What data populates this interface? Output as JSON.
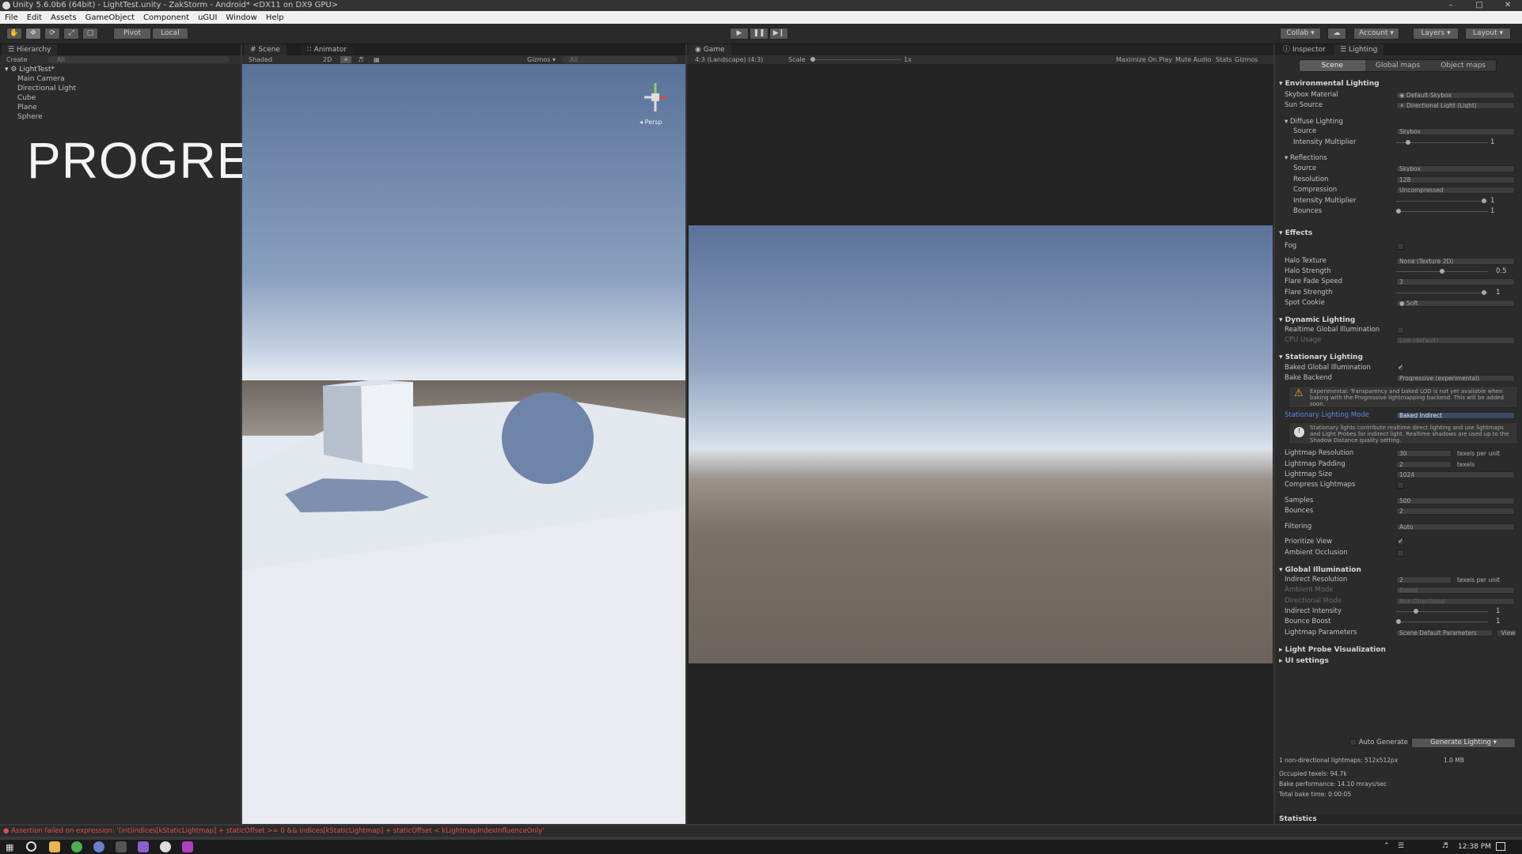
{
  "title_bar": {
    "text": "Unity 5.6.0b6 (64bit) - LightTest.unity - ZakStorm - Android* <DX11 on DX9 GPU>"
  },
  "menu": [
    "File",
    "Edit",
    "Assets",
    "GameObject",
    "Component",
    "uGUI",
    "Window",
    "Help"
  ],
  "toolbar": {
    "pivot": "Pivot",
    "local": "Local",
    "collab": "Collab",
    "account": "Account",
    "layers": "Layers",
    "layout": "Layout"
  },
  "hierarchy": {
    "tab": "Hierarchy",
    "create": "Create",
    "search_placeholder": "All",
    "scene": "LightTest*",
    "items": [
      "Main Camera",
      "Directional Light",
      "Cube",
      "Plane",
      "Sphere"
    ]
  },
  "overlay_text": "PROGRESSIVE",
  "scene_view": {
    "tab_scene": "Scene",
    "tab_animator": "Animator",
    "shading": "Shaded",
    "mode_2d": "2D",
    "gizmos": "Gizmos",
    "search": "All",
    "persp": "Persp"
  },
  "game_view": {
    "tab": "Game",
    "aspect": "4:3 (Landscape) (4:3)",
    "scale_label": "Scale",
    "scale_value": "1x",
    "maximize": "Maximize On Play",
    "mute": "Mute Audio",
    "stats": "Stats",
    "gizmos": "Gizmos"
  },
  "inspector_tabs": {
    "inspector": "Inspector",
    "lighting": "Lighting"
  },
  "lighting_tabs": [
    "Scene",
    "Global maps",
    "Object maps"
  ],
  "environment": {
    "header": "Environmental Lighting",
    "skybox_label": "Skybox Material",
    "skybox_value": "Default-Skybox",
    "sun_label": "Sun Source",
    "sun_value": "Directional Light (Light)",
    "diffuse_header": "Diffuse Lighting",
    "diffuse_source_label": "Source",
    "diffuse_source_value": "Skybox",
    "diffuse_intensity_label": "Intensity Multiplier",
    "diffuse_intensity_value": "1",
    "reflections_header": "Reflections",
    "ref_source_label": "Source",
    "ref_source_value": "Skybox",
    "ref_resolution_label": "Resolution",
    "ref_resolution_value": "128",
    "ref_compression_label": "Compression",
    "ref_compression_value": "Uncompressed",
    "ref_intensity_label": "Intensity Multiplier",
    "ref_intensity_value": "1",
    "ref_bounces_label": "Bounces",
    "ref_bounces_value": "1"
  },
  "effects": {
    "header": "Effects",
    "fog": "Fog",
    "halo_texture_label": "Halo Texture",
    "halo_texture_value": "None (Texture 2D)",
    "halo_strength_label": "Halo Strength",
    "halo_strength_value": "0.5",
    "flare_fade_label": "Flare Fade Speed",
    "flare_fade_value": "3",
    "flare_strength_label": "Flare Strength",
    "flare_strength_value": "1",
    "spot_cookie_label": "Spot Cookie",
    "spot_cookie_value": "Soft"
  },
  "dynamic": {
    "header": "Dynamic Lighting",
    "realtime_gi": "Realtime Global Illumination",
    "cpu_usage_label": "CPU Usage",
    "cpu_usage_value": "Low (default)"
  },
  "stationary": {
    "header": "Stationary Lighting",
    "baked_gi": "Baked Global Illumination",
    "bake_backend_label": "Bake Backend",
    "bake_backend_value": "Progressive (experimental)",
    "warning": "Experimental: Transparency and baked LOD is not yet available when baking with the Progressive lightmapping backend. This will be added soon.",
    "mode_label": "Stationary Lighting Mode",
    "mode_value": "Baked Indirect",
    "info": "Stationary lights contribute realtime direct lighting and use lightmaps and Light Probes for indirect light. Realtime shadows are used up to the Shadow Distance quality setting.",
    "lm_res_label": "Lightmap Resolution",
    "lm_res_value": "30",
    "lm_res_unit": "texels per unit",
    "lm_pad_label": "Lightmap Padding",
    "lm_pad_value": "2",
    "lm_pad_unit": "texels",
    "lm_size_label": "Lightmap Size",
    "lm_size_value": "1024",
    "compress_label": "Compress Lightmaps",
    "samples_label": "Samples",
    "samples_value": "500",
    "bounces_label": "Bounces",
    "bounces_value": "2",
    "filtering_label": "Filtering",
    "filtering_value": "Auto",
    "prioritize_label": "Prioritize View",
    "ao_label": "Ambient Occlusion"
  },
  "global_illumination": {
    "header": "Global Illumination",
    "indirect_res_label": "Indirect Resolution",
    "indirect_res_value": "2",
    "indirect_res_unit": "texels per unit",
    "ambient_mode_label": "Ambient Mode",
    "ambient_mode_value": "Baked",
    "directional_label": "Directional Mode",
    "directional_value": "Non-Directional",
    "indirect_int_label": "Indirect Intensity",
    "indirect_int_value": "1",
    "bounce_boost_label": "Bounce Boost",
    "bounce_boost_value": "1",
    "lm_params_label": "Lightmap Parameters",
    "lm_params_value": "Scene Default Parameters",
    "view": "View"
  },
  "foldouts": {
    "probe": "Light Probe Visualization",
    "ui": "UI settings"
  },
  "generate": {
    "auto": "Auto Generate",
    "button": "Generate Lighting"
  },
  "stats_info": {
    "lightmaps": "1 non-directional lightmaps: 512x512px",
    "size": "1.0 MB",
    "occupied": "Occupied texels: 94.7k",
    "performance": "Bake performance: 14.10 mrays/sec",
    "bake_time": "Total bake time: 0:00:05"
  },
  "statistics_header": "Statistics",
  "console_error": "Assertion failed on expression: '(int)indices[kStaticLightmap] + staticOffset >= 0 && indices[kStaticLightmap] + staticOffset < kLightmapIndexInfluenceOnly'",
  "taskbar": {
    "time": "12:38 PM"
  },
  "colors": {
    "sky_top": "#5a7199",
    "sky_horizon": "#dfe6ef",
    "ground": "#726a63",
    "error": "#e05050",
    "link": "#5a8ee6"
  }
}
